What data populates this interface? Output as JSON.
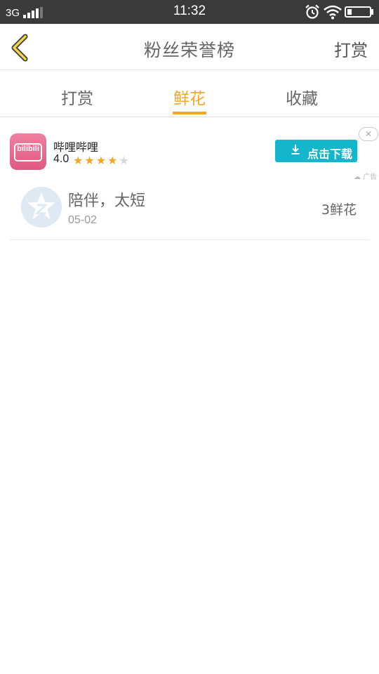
{
  "status_bar": {
    "network": "3G",
    "time": "11:32",
    "battery_level": 0.2
  },
  "header": {
    "title": "粉丝荣誉榜",
    "right_action": "打赏",
    "back_icon": "chevron-left-icon",
    "accent_color": "#f5a623"
  },
  "tabs": [
    {
      "label": "打赏",
      "active": false
    },
    {
      "label": "鲜花",
      "active": true
    },
    {
      "label": "收藏",
      "active": false
    }
  ],
  "ad": {
    "app_icon_text": "bilibili",
    "app_name": "哔哩哔哩",
    "rating": "4.0",
    "stars": 4,
    "max_stars": 5,
    "download_label": "点击下载",
    "ad_tag": "广告",
    "button_color": "#14b6cc"
  },
  "list": [
    {
      "name": "陪伴，太短",
      "date": "05-02",
      "count": "3鲜花"
    }
  ]
}
